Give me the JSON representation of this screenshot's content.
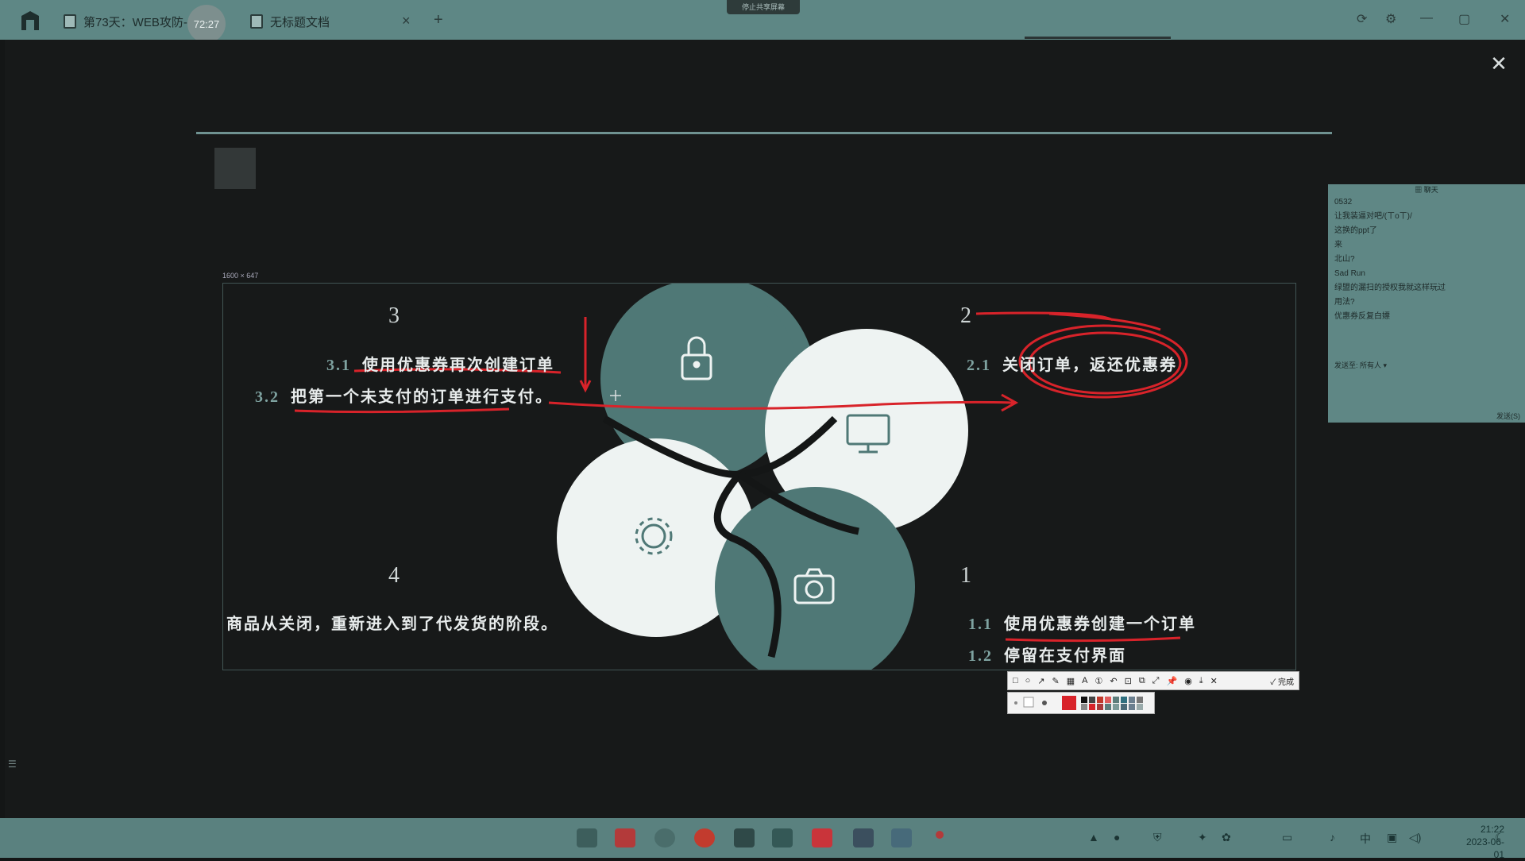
{
  "window": {
    "tabs": [
      {
        "label": "第73天：WEB攻防-3"
      },
      {
        "label": "无标题文档"
      }
    ],
    "timer": "72:27",
    "share_tag": "停止共享屏幕",
    "add_tab": "+",
    "close_tab": "×"
  },
  "viewer": {
    "close_label": "✕",
    "selection_size": "1600 × 647"
  },
  "slide": {
    "steps": [
      {
        "num": "3",
        "items": [
          {
            "n": "3.1",
            "text": "使用优惠券再次创建订单"
          },
          {
            "n": "3.2",
            "text": "把第一个未支付的订单进行支付。"
          }
        ]
      },
      {
        "num": "2",
        "items": [
          {
            "n": "2.1",
            "text": "关闭订单，返还优惠券"
          }
        ]
      },
      {
        "num": "4",
        "items": [
          {
            "n": "",
            "text": "商品从关闭，重新进入到了代发货的阶段。"
          }
        ]
      },
      {
        "num": "1",
        "items": [
          {
            "n": "1.1",
            "text": "使用优惠券创建一个订单"
          },
          {
            "n": "1.2",
            "text": "停留在支付界面"
          }
        ]
      }
    ],
    "petal_icons": [
      "lock-icon",
      "monitor-icon",
      "gear-icon",
      "camera-icon"
    ],
    "colors": {
      "teal": "#4f7876",
      "light": "#eef3f2",
      "ink": "#d8232a"
    }
  },
  "annotation_toolbar": {
    "done_label": "完成",
    "palette_colors": [
      "#d8232a",
      "#111111",
      "#444444",
      "#c0392b",
      "#e05c5c",
      "#5d7d7b",
      "#2f6f7f",
      "#6b7f8f"
    ]
  },
  "chat": {
    "title": "聊天",
    "messages": [
      "0532",
      "让我装逼对吧/(ㄒoㄒ)/",
      "这换的ppt了",
      "来",
      "北山?",
      "Sad Run",
      "绿盟的漏扫的授权我就这样玩过",
      "用法?",
      "优惠券反复白嫖"
    ],
    "send_to_label": "发送至:",
    "send_to_value": "所有人",
    "send_button": "发送(S)"
  },
  "taskbar": {
    "time": "21:22",
    "date": "2023-06-01"
  }
}
